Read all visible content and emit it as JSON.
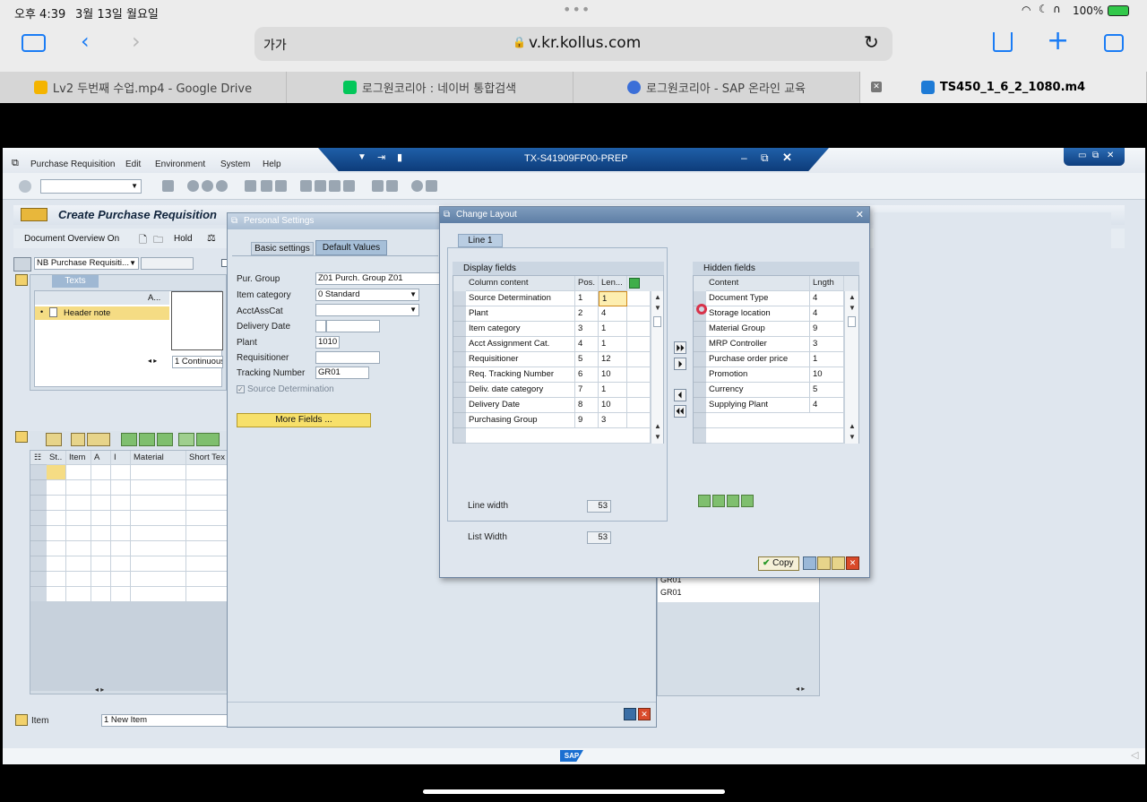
{
  "status": {
    "time": "오후 4:39",
    "date": "3월 13일 월요일",
    "battery": "100%"
  },
  "safari": {
    "text_size": "가가",
    "url": "v.kr.kollus.com"
  },
  "browser_tabs": [
    {
      "label": "Lv2 두번째 수업.mp4 - Google Drive",
      "icon": "google-drive-icon",
      "color": "#f4b400"
    },
    {
      "label": "로그원코리아 : 네이버 통합검색",
      "icon": "naver-icon",
      "color": "#03c75a"
    },
    {
      "label": "로그원코리아 - SAP 온라인 교육",
      "icon": "play-icon",
      "color": "#3b6fd8"
    },
    {
      "label": "TS450_1_6_2_1080.m4",
      "icon": "kollus-icon",
      "color": "#1e7bd6"
    }
  ],
  "sap": {
    "menu": [
      "Purchase Requisition",
      "Edit",
      "Environment",
      "System",
      "Help"
    ],
    "system_title": "TX-S41909FP00-PREP",
    "screen_title": "Create Purchase Requisition",
    "apptb": {
      "doc_overview": "Document Overview On",
      "hold": "Hold"
    },
    "doc_type": "NB Purchase Requisiti...",
    "texts_tab": "Texts",
    "texts_col": "A...",
    "header_note": "Header note",
    "text_format": "1 Continuous-",
    "items_cols": [
      "St..",
      "Item",
      "A",
      "I",
      "Material",
      "Short Tex"
    ],
    "item_label": "Item",
    "item_value": "1 New Item",
    "sap_logo": "SAP",
    "bg_rows": [
      "GR01",
      "GR01"
    ]
  },
  "personal_settings": {
    "title": "Personal Settings",
    "tabs": [
      "Basic settings",
      "Default Values"
    ],
    "fields": [
      {
        "label": "Pur. Group",
        "value": "Z01 Purch. Group Z01"
      },
      {
        "label": "Item category",
        "value": "0 Standard"
      },
      {
        "label": "AcctAssCat",
        "value": ""
      },
      {
        "label": "Delivery Date",
        "value": ""
      },
      {
        "label": "Plant",
        "value": "1010"
      },
      {
        "label": "Requisitioner",
        "value": ""
      },
      {
        "label": "Tracking Number",
        "value": "GR01"
      }
    ],
    "checkbox": "Source Determination",
    "more_fields": "More Fields ..."
  },
  "change_layout": {
    "title": "Change Layout",
    "tab": "Line 1",
    "display_title": "Display fields",
    "display_cols": [
      "Column content",
      "Pos.",
      "Len..."
    ],
    "display_rows": [
      {
        "content": "Source Determination",
        "pos": "1",
        "len": "1"
      },
      {
        "content": "Plant",
        "pos": "2",
        "len": "4"
      },
      {
        "content": "Item category",
        "pos": "3",
        "len": "1"
      },
      {
        "content": "Acct Assignment Cat.",
        "pos": "4",
        "len": "1"
      },
      {
        "content": "Requisitioner",
        "pos": "5",
        "len": "12"
      },
      {
        "content": "Req. Tracking Number",
        "pos": "6",
        "len": "10"
      },
      {
        "content": "Deliv. date category",
        "pos": "7",
        "len": "1"
      },
      {
        "content": "Delivery Date",
        "pos": "8",
        "len": "10"
      },
      {
        "content": "Purchasing Group",
        "pos": "9",
        "len": "3"
      }
    ],
    "hidden_title": "Hidden fields",
    "hidden_cols": [
      "Content",
      "Lngth"
    ],
    "hidden_rows": [
      {
        "content": "Document Type",
        "len": "4"
      },
      {
        "content": "Storage location",
        "len": "4"
      },
      {
        "content": "Material Group",
        "len": "9"
      },
      {
        "content": "MRP Controller",
        "len": "3"
      },
      {
        "content": "Purchase order price",
        "len": "1"
      },
      {
        "content": "Promotion",
        "len": "10"
      },
      {
        "content": "Currency",
        "len": "5"
      },
      {
        "content": "Supplying Plant",
        "len": "4"
      }
    ],
    "line_width_label": "Line width",
    "line_width": "53",
    "list_width_label": "List Width",
    "list_width": "53",
    "copy": "Copy"
  }
}
